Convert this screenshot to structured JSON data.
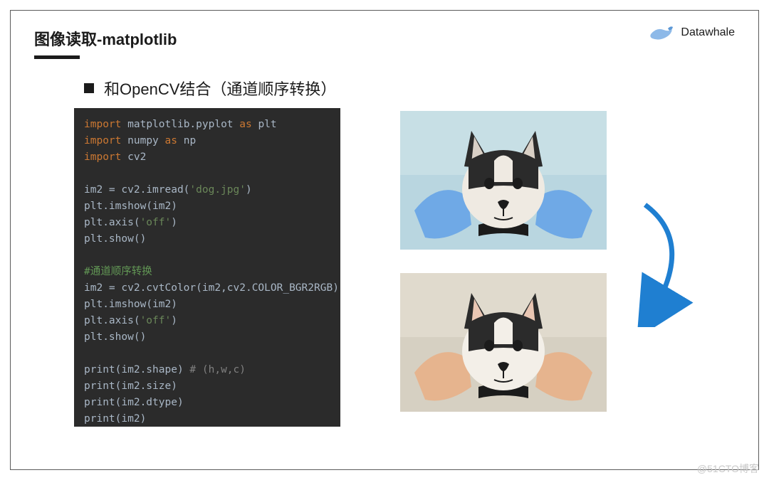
{
  "brand": {
    "name": "Datawhale"
  },
  "title": "图像读取-matplotlib",
  "subtitle": "和OpenCV结合（通道顺序转换）",
  "code": {
    "l01_kw1": "import",
    "l01_mod": "matplotlib.pyplot",
    "l01_kw2": "as",
    "l01_alias": "plt",
    "l02_kw1": "import",
    "l02_mod": "numpy",
    "l02_kw2": "as",
    "l02_alias": "np",
    "l03_kw1": "import",
    "l03_mod": "cv2",
    "l05_a": "im2 = cv2.imread(",
    "l05_str": "'dog.jpg'",
    "l05_b": ")",
    "l06": "plt.imshow(im2)",
    "l07_a": "plt.axis(",
    "l07_str": "'off'",
    "l07_b": ")",
    "l08": "plt.show()",
    "l10_cmt": "#通道顺序转换",
    "l11": "im2 = cv2.cvtColor(im2,cv2.COLOR_BGR2RGB)",
    "l12": "plt.imshow(im2)",
    "l13_a": "plt.axis(",
    "l13_str": "'off'",
    "l13_b": ")",
    "l14": "plt.show()",
    "l16_a": "print(im2.shape)",
    "l16_cmt": " # (h,w,c)",
    "l17": "print(im2.size)",
    "l18": "print(im2.dtype)",
    "l19": "print(im2)"
  },
  "images": {
    "top_alt": "husky-puppy-bgr-tinted",
    "bot_alt": "husky-puppy-rgb-correct"
  },
  "arrow_color": "#1f7fd1",
  "watermark": "@51CTO博客"
}
